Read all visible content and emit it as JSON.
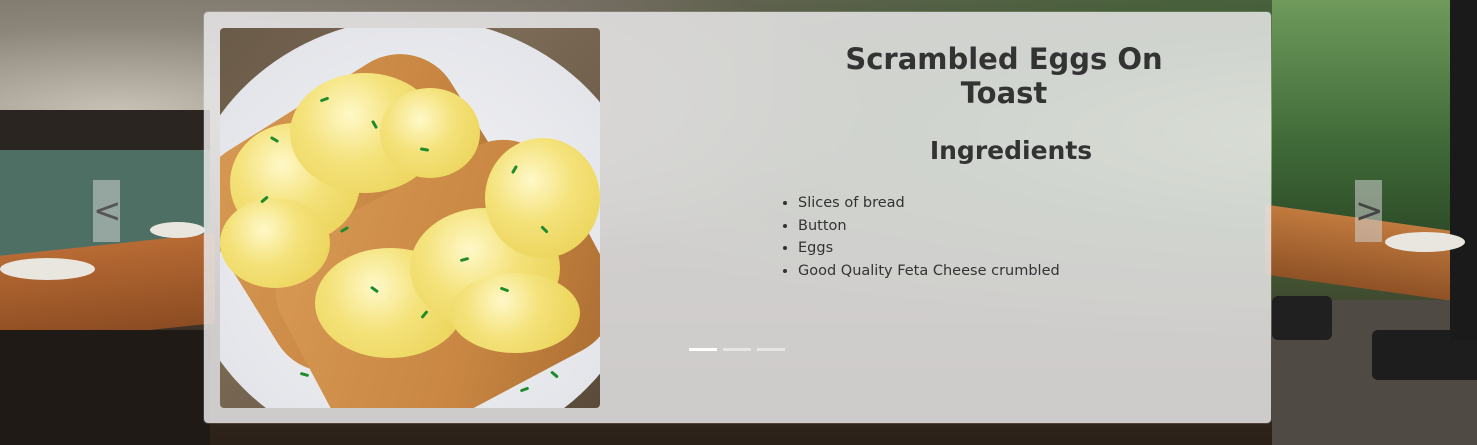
{
  "recipe": {
    "title": "Scrambled Eggs On Toast",
    "ingredients_heading": "Ingredients",
    "ingredients": [
      "Slices of bread",
      "Button",
      "Eggs",
      "Good Quality Feta Cheese crumbled"
    ]
  },
  "carousel": {
    "prev_label": "<",
    "next_label": ">",
    "slide_count": 3,
    "active_slide": 0
  },
  "icons": {
    "prev": "chevron-left-icon",
    "next": "chevron-right-icon"
  },
  "colors": {
    "card_bg": "#e8e6e8",
    "text": "#333333",
    "indicator_active": "#ffffff"
  }
}
